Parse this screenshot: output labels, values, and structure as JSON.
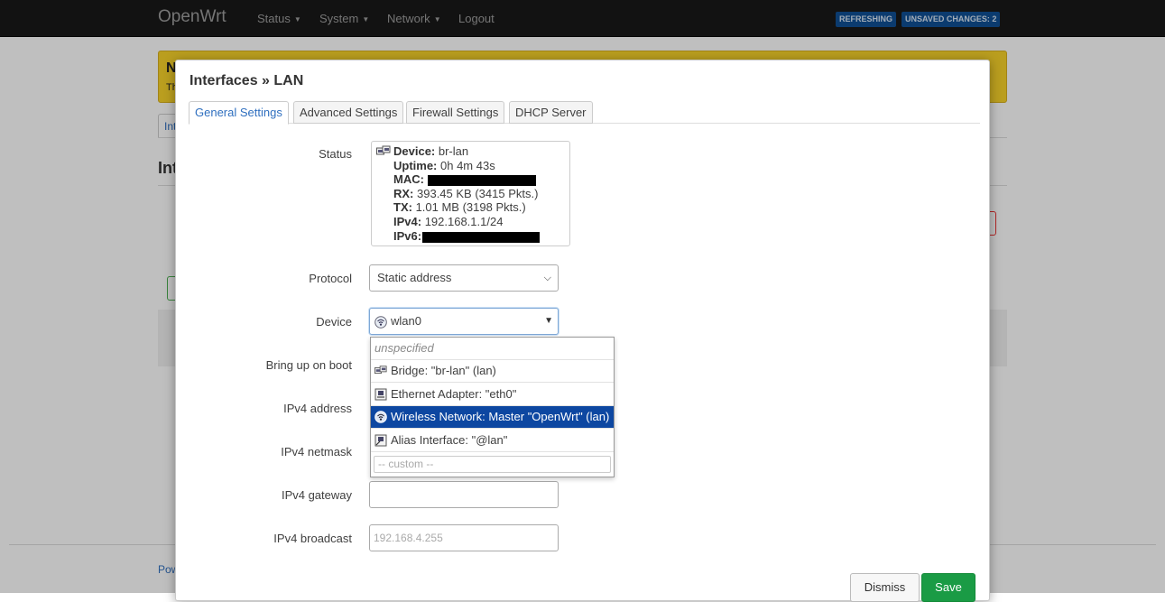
{
  "navbar": {
    "brand": "OpenWrt",
    "menu": [
      {
        "label": "Status"
      },
      {
        "label": "System"
      },
      {
        "label": "Network"
      },
      {
        "label": "Logout"
      }
    ],
    "badges": {
      "refreshing": "REFRESHING",
      "unsaved": "UNSAVED CHANGES: 2"
    }
  },
  "background": {
    "notice_title": "N",
    "notice_text": "Th",
    "tab_label": "Int",
    "heading": "Int",
    "footer": "Pow"
  },
  "modal": {
    "title": "Interfaces » LAN",
    "tabs": [
      {
        "label": "General Settings",
        "active": true
      },
      {
        "label": "Advanced Settings",
        "active": false
      },
      {
        "label": "Firewall Settings",
        "active": false
      },
      {
        "label": "DHCP Server",
        "active": false
      }
    ],
    "labels": {
      "status": "Status",
      "protocol": "Protocol",
      "device": "Device",
      "bring_up_on_boot": "Bring up on boot",
      "ipv4_address": "IPv4 address",
      "ipv4_netmask": "IPv4 netmask",
      "ipv4_gateway": "IPv4 gateway",
      "ipv4_broadcast": "IPv4 broadcast"
    },
    "status": {
      "device_label": "Device:",
      "device_value": " br-lan",
      "uptime_label": "Uptime:",
      "uptime_value": " 0h 4m 43s",
      "mac_label": "MAC:",
      "rx_label": "RX:",
      "rx_value": " 393.45 KB (3415 Pkts.)",
      "tx_label": "TX:",
      "tx_value": " 1.01 MB (3198 Pkts.)",
      "ipv4_label": "IPv4:",
      "ipv4_value": " 192.168.1.1/24",
      "ipv6_label": "IPv6:"
    },
    "protocol": {
      "selected": "Static address"
    },
    "device": {
      "selected": "wlan0",
      "options": [
        {
          "label": "unspecified",
          "icon": "none",
          "selected": false
        },
        {
          "label": "Bridge: \"br-lan\" (lan)",
          "icon": "bridge-icon",
          "selected": false
        },
        {
          "label": "Ethernet Adapter: \"eth0\"",
          "icon": "ethernet-icon",
          "selected": false
        },
        {
          "label": "Wireless Network: Master \"OpenWrt\" (lan)",
          "icon": "wifi-icon",
          "selected": true
        },
        {
          "label": "Alias Interface: \"@lan\"",
          "icon": "alias-icon",
          "selected": false
        }
      ],
      "custom_placeholder": "-- custom --"
    },
    "ipv4_gateway": {
      "value": ""
    },
    "ipv4_broadcast": {
      "placeholder": "192.168.4.255"
    },
    "buttons": {
      "dismiss": "Dismiss",
      "save": "Save"
    }
  }
}
